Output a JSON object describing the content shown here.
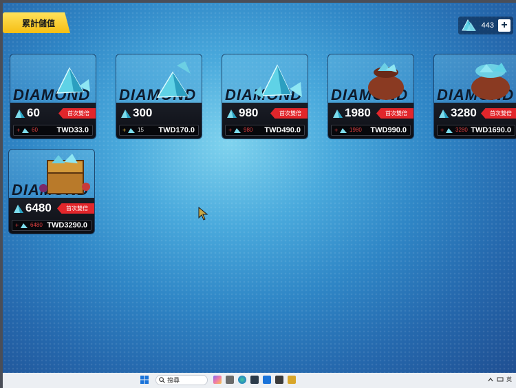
{
  "header": {
    "title": "累計儲值"
  },
  "currency": {
    "amount": "443",
    "add_label": "+"
  },
  "cards": [
    {
      "brand": "DIAMOND",
      "count": "60",
      "tag": "首次雙倍",
      "bonus": "60",
      "price": "TWD33.0"
    },
    {
      "brand": "DIAMOND",
      "count": "300",
      "tag": "",
      "bonus": "15",
      "price": "TWD170.0"
    },
    {
      "brand": "DIAMOND",
      "count": "980",
      "tag": "首次雙倍",
      "bonus": "980",
      "price": "TWD490.0"
    },
    {
      "brand": "DIAMOND",
      "count": "1980",
      "tag": "首次雙倍",
      "bonus": "1980",
      "price": "TWD990.0"
    },
    {
      "brand": "DIAMOND",
      "count": "3280",
      "tag": "首次雙倍",
      "bonus": "3280",
      "price": "TWD1690.0"
    },
    {
      "brand": "DIAMOND",
      "count": "6480",
      "tag": "首次雙倍",
      "bonus": "6480",
      "price": "TWD3290.0"
    }
  ],
  "taskbar": {
    "search_placeholder": "搜尋",
    "icons": [
      "windows-icon",
      "search-icon",
      "copilot-icon",
      "edge-icon",
      "mail-icon",
      "store-icon",
      "app-icon",
      "game-icon"
    ],
    "tray_text": "英"
  },
  "colors": {
    "accent_yellow": "#f6be14",
    "tag_red": "#e2262b",
    "bonus_red": "#e24040"
  }
}
